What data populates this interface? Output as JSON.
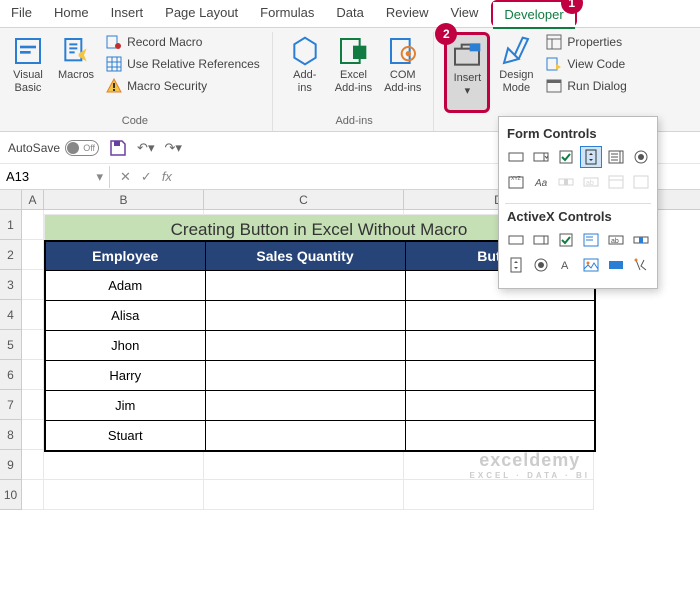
{
  "tabs": [
    "File",
    "Home",
    "Insert",
    "Page Layout",
    "Formulas",
    "Data",
    "Review",
    "View",
    "Developer"
  ],
  "ribbon": {
    "code": {
      "visual_basic": "Visual\nBasic",
      "macros": "Macros",
      "record_macro": "Record Macro",
      "use_rel": "Use Relative References",
      "macro_sec": "Macro Security",
      "group": "Code"
    },
    "addins": {
      "addins": "Add-\nins",
      "excel_addins": "Excel\nAdd-ins",
      "com_addins": "COM\nAdd-ins",
      "group": "Add-ins"
    },
    "controls": {
      "insert": "Insert",
      "design_mode": "Design\nMode",
      "properties": "Properties",
      "view_code": "View Code",
      "run_dialog": "Run Dialog"
    }
  },
  "callouts": {
    "one": "1",
    "two": "2"
  },
  "qat": {
    "autosave": "AutoSave",
    "off": "Off"
  },
  "namebox": "A13",
  "sheet": {
    "title": "Creating Button in Excel Without Macro",
    "headers": [
      "Employee",
      "Sales Quantity",
      "Button"
    ],
    "rows": [
      "Adam",
      "Alisa",
      "Jhon",
      "Harry",
      "Jim",
      "Stuart"
    ]
  },
  "panel": {
    "form": "Form Controls",
    "activex": "ActiveX Controls"
  },
  "watermark": {
    "main": "exceldemy",
    "sub": "EXCEL · DATA · BI"
  },
  "col_labels": [
    "A",
    "B",
    "C",
    "D"
  ],
  "row_labels": [
    "1",
    "2",
    "3",
    "4",
    "5",
    "6",
    "7",
    "8",
    "9",
    "10"
  ]
}
